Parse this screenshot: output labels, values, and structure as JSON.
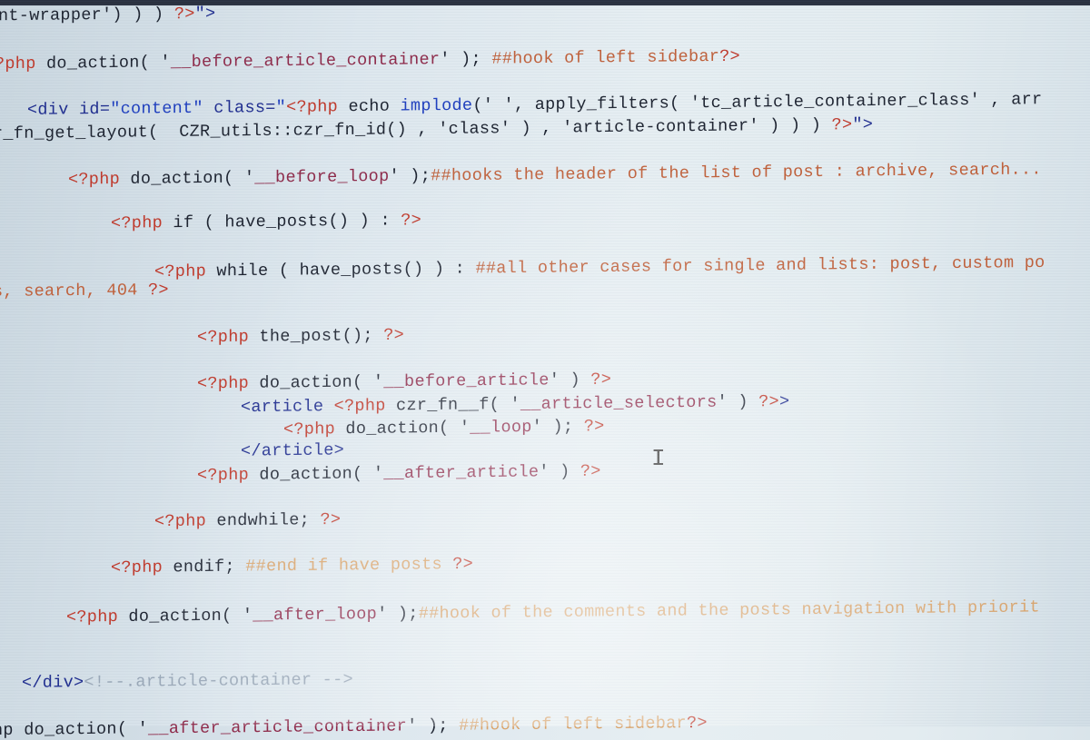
{
  "editor": {
    "language": "php",
    "lines": [
      {
        "id": "l1",
        "parts": [
          {
            "t": "nt-wrapper') ) ) ",
            "c": "plain"
          },
          {
            "t": "?>",
            "c": "kw"
          },
          {
            "t": "\">",
            "c": "tag"
          }
        ]
      },
      {
        "id": "l2",
        "parts": [
          {
            "t": "?php",
            "c": "kw"
          },
          {
            "t": " do_action( '",
            "c": "plain"
          },
          {
            "t": "__before_article_container",
            "c": "str"
          },
          {
            "t": "' ); ",
            "c": "plain"
          },
          {
            "t": "##hook of left sidebar",
            "c": "cmt"
          },
          {
            "t": "?>",
            "c": "kw"
          }
        ]
      },
      {
        "id": "l3",
        "parts": [
          {
            "t": "<div id=",
            "c": "tag"
          },
          {
            "t": "\"content\"",
            "c": "blue"
          },
          {
            "t": " class=",
            "c": "tag"
          },
          {
            "t": "\"",
            "c": "blue"
          },
          {
            "t": "<?php",
            "c": "kw"
          },
          {
            "t": " echo ",
            "c": "plain"
          },
          {
            "t": "implode",
            "c": "blue"
          },
          {
            "t": "(' ', apply_filters( 'tc_article_container_class' , arr",
            "c": "plain"
          }
        ]
      },
      {
        "id": "l4",
        "parts": [
          {
            "t": "r_fn_get_layout(  CZR_utils::czr_fn_id() , 'class' ) , 'article-container' ) ) ) ",
            "c": "plain"
          },
          {
            "t": "?>",
            "c": "kw"
          },
          {
            "t": "\">",
            "c": "tag"
          }
        ]
      },
      {
        "id": "l5",
        "parts": [
          {
            "t": "<?php",
            "c": "kw"
          },
          {
            "t": " do_action( '",
            "c": "plain"
          },
          {
            "t": "__before_loop",
            "c": "str"
          },
          {
            "t": "' );",
            "c": "plain"
          },
          {
            "t": "##hooks the header of the list of post : archive, search...",
            "c": "cmt"
          }
        ]
      },
      {
        "id": "l6",
        "parts": [
          {
            "t": "<?php",
            "c": "kw"
          },
          {
            "t": " if ( have_posts() ) : ",
            "c": "plain"
          },
          {
            "t": "?>",
            "c": "kw"
          }
        ]
      },
      {
        "id": "l7",
        "parts": [
          {
            "t": "<?php",
            "c": "kw"
          },
          {
            "t": " while ( have_posts() ) : ",
            "c": "plain"
          },
          {
            "t": "##all other cases for single and lists: post, custom po",
            "c": "cmt"
          }
        ]
      },
      {
        "id": "l8",
        "parts": [
          {
            "t": "s, search, 404 ",
            "c": "cmt"
          },
          {
            "t": "?>",
            "c": "kw"
          }
        ]
      },
      {
        "id": "l9",
        "parts": [
          {
            "t": "<?php",
            "c": "kw"
          },
          {
            "t": " the_post(); ",
            "c": "plain"
          },
          {
            "t": "?>",
            "c": "kw"
          }
        ]
      },
      {
        "id": "l10",
        "parts": [
          {
            "t": "<?php",
            "c": "kw"
          },
          {
            "t": " do_action( '",
            "c": "plain"
          },
          {
            "t": "__before_article",
            "c": "str"
          },
          {
            "t": "' ) ",
            "c": "plain"
          },
          {
            "t": "?>",
            "c": "kw"
          }
        ]
      },
      {
        "id": "l11",
        "parts": [
          {
            "t": "<article ",
            "c": "tag"
          },
          {
            "t": "<?php",
            "c": "kw"
          },
          {
            "t": " czr_fn__f( '",
            "c": "plain"
          },
          {
            "t": "__article_selectors",
            "c": "str"
          },
          {
            "t": "' ) ",
            "c": "plain"
          },
          {
            "t": "?>",
            "c": "kw"
          },
          {
            "t": ">",
            "c": "tag"
          }
        ]
      },
      {
        "id": "l12",
        "parts": [
          {
            "t": "<?php",
            "c": "kw"
          },
          {
            "t": " do_action( '",
            "c": "plain"
          },
          {
            "t": "__loop",
            "c": "str"
          },
          {
            "t": "' ); ",
            "c": "plain"
          },
          {
            "t": "?>",
            "c": "kw"
          }
        ]
      },
      {
        "id": "l13",
        "parts": [
          {
            "t": "</article>",
            "c": "tag"
          }
        ]
      },
      {
        "id": "l14",
        "parts": [
          {
            "t": "<?php",
            "c": "kw"
          },
          {
            "t": " do_action( '",
            "c": "plain"
          },
          {
            "t": "__after_article",
            "c": "str"
          },
          {
            "t": "' ) ",
            "c": "plain"
          },
          {
            "t": "?>",
            "c": "kw"
          }
        ]
      },
      {
        "id": "l15",
        "parts": [
          {
            "t": "<?php",
            "c": "kw"
          },
          {
            "t": " endwhile; ",
            "c": "plain"
          },
          {
            "t": "?>",
            "c": "kw"
          }
        ]
      },
      {
        "id": "l16",
        "parts": [
          {
            "t": "<?php",
            "c": "kw"
          },
          {
            "t": " endif; ",
            "c": "plain"
          },
          {
            "t": "##end if have posts ",
            "c": "cmt-faint"
          },
          {
            "t": "?>",
            "c": "kw"
          }
        ]
      },
      {
        "id": "l17",
        "parts": [
          {
            "t": "<?php",
            "c": "kw"
          },
          {
            "t": " do_action( '",
            "c": "plain"
          },
          {
            "t": "__after_loop",
            "c": "str"
          },
          {
            "t": "' );",
            "c": "plain"
          },
          {
            "t": "##hook of the comments and the posts navigation with priorit",
            "c": "cmt-faint"
          }
        ]
      },
      {
        "id": "l18",
        "parts": [
          {
            "t": "</div>",
            "c": "tag"
          },
          {
            "t": "<!--.article-container -->",
            "c": "cmt-gray"
          }
        ]
      },
      {
        "id": "l19",
        "parts": [
          {
            "t": "hp do_action( '",
            "c": "plain"
          },
          {
            "t": "__after_article_container",
            "c": "str"
          },
          {
            "t": "' ); ",
            "c": "plain"
          },
          {
            "t": "##hook of left sidebar",
            "c": "cmt-faint"
          },
          {
            "t": "?>",
            "c": "kw"
          }
        ]
      }
    ]
  },
  "cursor": {
    "icon": "text-cursor-icon",
    "glyph": "I"
  }
}
